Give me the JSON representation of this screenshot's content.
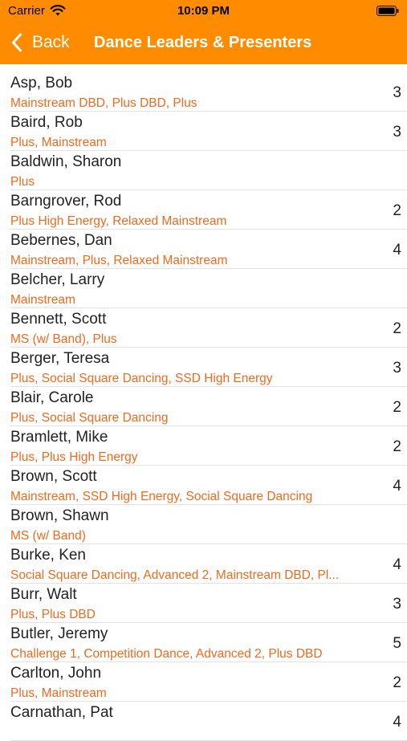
{
  "status_bar": {
    "carrier": "Carrier",
    "time": "10:09 PM"
  },
  "nav": {
    "back_label": "Back",
    "title": "Dance Leaders & Presenters"
  },
  "colors": {
    "accent": "#ff8c00",
    "subtitle": "#ef6a1f"
  },
  "icons": {
    "back": "chevron-left-icon",
    "wifi": "wifi-icon",
    "battery": "battery-icon"
  },
  "leaders": [
    {
      "name": "Asp, Bob",
      "levels": "Mainstream DBD, Plus DBD, Plus",
      "count": "3"
    },
    {
      "name": "Baird, Rob",
      "levels": "Plus, Mainstream",
      "count": "3"
    },
    {
      "name": "Baldwin, Sharon",
      "levels": "Plus",
      "count": ""
    },
    {
      "name": "Barngrover, Rod",
      "levels": "Plus High Energy, Relaxed Mainstream",
      "count": "2"
    },
    {
      "name": "Bebernes, Dan",
      "levels": "Mainstream, Plus, Relaxed Mainstream",
      "count": "4"
    },
    {
      "name": "Belcher, Larry",
      "levels": "Mainstream",
      "count": ""
    },
    {
      "name": "Bennett, Scott",
      "levels": "MS (w/ Band), Plus",
      "count": "2"
    },
    {
      "name": "Berger, Teresa",
      "levels": "Plus, Social Square Dancing, SSD High Energy",
      "count": "3"
    },
    {
      "name": "Blair, Carole",
      "levels": "Plus, Social Square Dancing",
      "count": "2"
    },
    {
      "name": "Bramlett, Mike",
      "levels": "Plus, Plus High Energy",
      "count": "2"
    },
    {
      "name": "Brown, Scott",
      "levels": "Mainstream, SSD High Energy, Social Square Dancing",
      "count": "4"
    },
    {
      "name": "Brown, Shawn",
      "levels": "MS (w/ Band)",
      "count": ""
    },
    {
      "name": "Burke, Ken",
      "levels": "Social Square Dancing, Advanced 2, Mainstream DBD, Pl...",
      "count": "4"
    },
    {
      "name": "Burr, Walt",
      "levels": "Plus, Plus DBD",
      "count": "3"
    },
    {
      "name": "Butler, Jeremy",
      "levels": "Challenge 1, Competition Dance, Advanced 2, Plus DBD",
      "count": "5"
    },
    {
      "name": "Carlton, John",
      "levels": "Plus, Mainstream",
      "count": "2"
    },
    {
      "name": "Carnathan, Pat",
      "levels": "",
      "count": "4"
    }
  ]
}
